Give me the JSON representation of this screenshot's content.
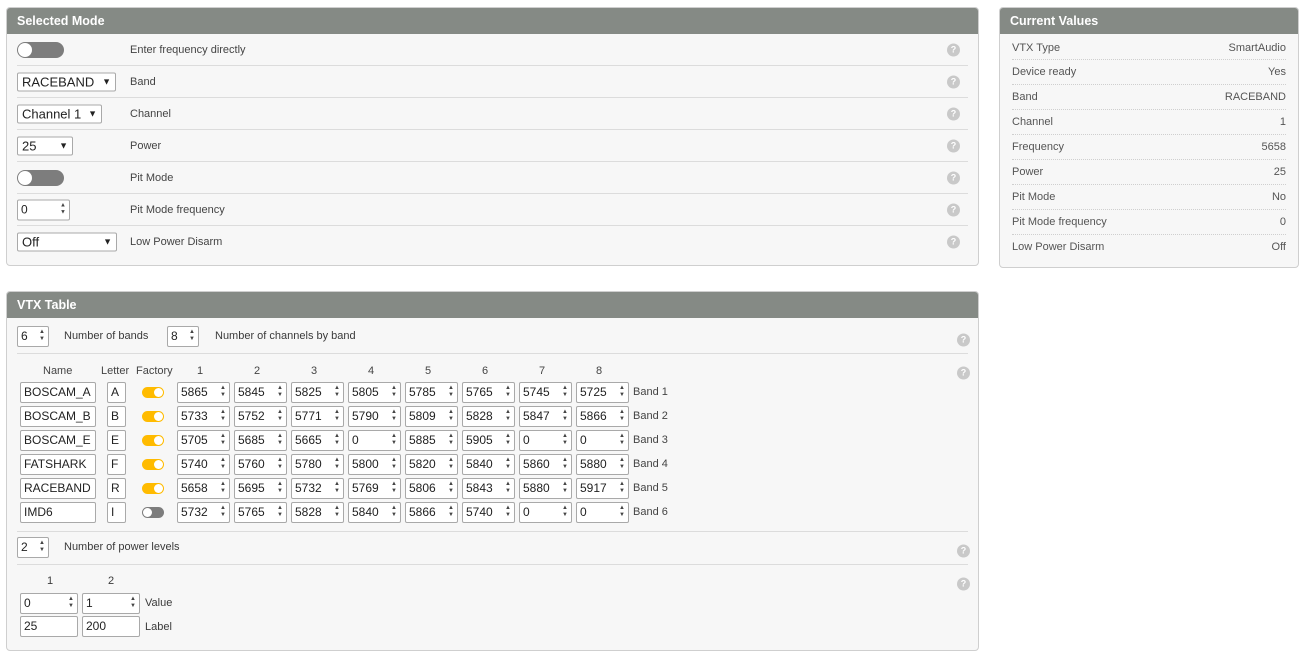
{
  "selected_mode": {
    "title": "Selected Mode",
    "rows": [
      {
        "type": "toggle",
        "label": "Enter frequency directly"
      },
      {
        "type": "select",
        "value": "RACEBAND",
        "label": "Band"
      },
      {
        "type": "select",
        "value": "Channel 1",
        "label": "Channel"
      },
      {
        "type": "select",
        "value": "25",
        "label": "Power"
      },
      {
        "type": "toggle",
        "label": "Pit Mode"
      },
      {
        "type": "number",
        "value": "0",
        "label": "Pit Mode frequency"
      },
      {
        "type": "select",
        "value": "Off",
        "label": "Low Power Disarm"
      }
    ]
  },
  "current_values": {
    "title": "Current Values",
    "rows": [
      {
        "label": "VTX Type",
        "value": "SmartAudio"
      },
      {
        "label": "Device ready",
        "value": "Yes"
      },
      {
        "label": "Band",
        "value": "RACEBAND"
      },
      {
        "label": "Channel",
        "value": "1"
      },
      {
        "label": "Frequency",
        "value": "5658"
      },
      {
        "label": "Power",
        "value": "25"
      },
      {
        "label": "Pit Mode",
        "value": "No"
      },
      {
        "label": "Pit Mode frequency",
        "value": "0"
      },
      {
        "label": "Low Power Disarm",
        "value": "Off"
      }
    ]
  },
  "vtx_table": {
    "title": "VTX Table",
    "num_bands": "6",
    "num_bands_label": "Number of bands",
    "num_channels": "8",
    "num_channels_label": "Number of channels by band",
    "headers": {
      "name": "Name",
      "letter": "Letter",
      "factory": "Factory",
      "channels": [
        "1",
        "2",
        "3",
        "4",
        "5",
        "6",
        "7",
        "8"
      ]
    },
    "bands": [
      {
        "name": "BOSCAM_A",
        "letter": "A",
        "factory": true,
        "freqs": [
          "5865",
          "5845",
          "5825",
          "5805",
          "5785",
          "5765",
          "5745",
          "5725"
        ],
        "label": "Band 1"
      },
      {
        "name": "BOSCAM_B",
        "letter": "B",
        "factory": true,
        "freqs": [
          "5733",
          "5752",
          "5771",
          "5790",
          "5809",
          "5828",
          "5847",
          "5866"
        ],
        "label": "Band 2"
      },
      {
        "name": "BOSCAM_E",
        "letter": "E",
        "factory": true,
        "freqs": [
          "5705",
          "5685",
          "5665",
          "0",
          "5885",
          "5905",
          "0",
          "0"
        ],
        "label": "Band 3"
      },
      {
        "name": "FATSHARK",
        "letter": "F",
        "factory": true,
        "freqs": [
          "5740",
          "5760",
          "5780",
          "5800",
          "5820",
          "5840",
          "5860",
          "5880"
        ],
        "label": "Band 4"
      },
      {
        "name": "RACEBAND",
        "letter": "R",
        "factory": true,
        "freqs": [
          "5658",
          "5695",
          "5732",
          "5769",
          "5806",
          "5843",
          "5880",
          "5917"
        ],
        "label": "Band 5"
      },
      {
        "name": "IMD6",
        "letter": "I",
        "factory": false,
        "freqs": [
          "5732",
          "5765",
          "5828",
          "5840",
          "5866",
          "5740",
          "0",
          "0"
        ],
        "label": "Band 6"
      }
    ],
    "num_power_levels": "2",
    "num_power_levels_label": "Number of power levels",
    "power_headers": [
      "1",
      "2"
    ],
    "power_values": [
      "0",
      "1"
    ],
    "power_value_label": "Value",
    "power_labels": [
      "25",
      "200"
    ],
    "power_label_label": "Label"
  },
  "help_glyph": "?"
}
